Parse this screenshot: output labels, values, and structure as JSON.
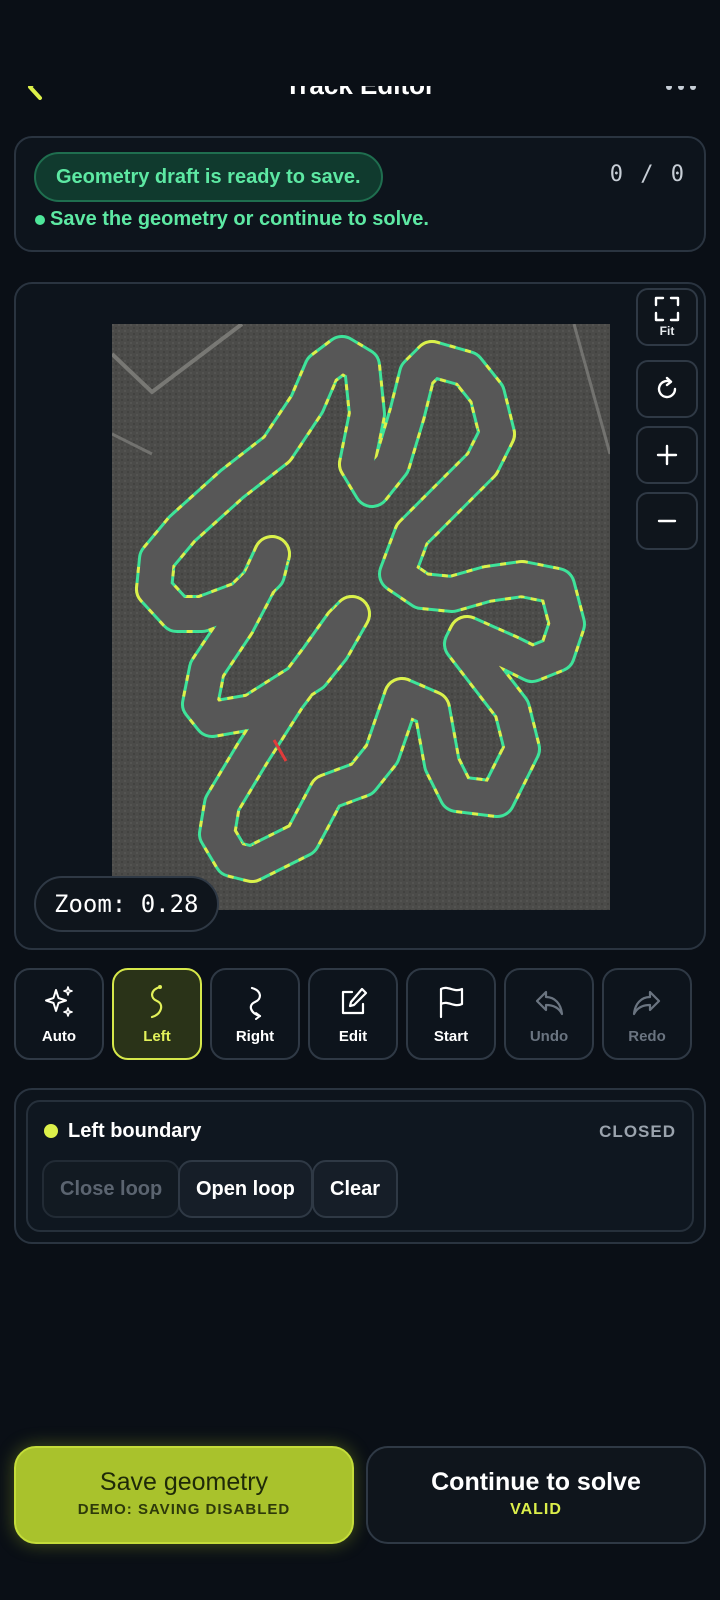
{
  "header": {
    "title": "Track Editor"
  },
  "status": {
    "pill": "Geometry draft is ready to save.",
    "counter": "0 / 0",
    "message": "Save the geometry or continue to solve."
  },
  "map": {
    "controls": {
      "fit_label": "Fit"
    },
    "zoom_text": "Zoom: 0.28"
  },
  "toolbar": {
    "tools": [
      {
        "label": "Auto",
        "icon": "sparkles-icon",
        "state": "normal"
      },
      {
        "label": "Left",
        "icon": "left-boundary-icon",
        "state": "active"
      },
      {
        "label": "Right",
        "icon": "right-boundary-icon",
        "state": "normal"
      },
      {
        "label": "Edit",
        "icon": "edit-icon",
        "state": "normal"
      },
      {
        "label": "Start",
        "icon": "flag-icon",
        "state": "normal"
      },
      {
        "label": "Undo",
        "icon": "undo-icon",
        "state": "disabled"
      },
      {
        "label": "Redo",
        "icon": "redo-icon",
        "state": "disabled"
      }
    ]
  },
  "boundary": {
    "title": "Left boundary",
    "state": "CLOSED",
    "close_loop": "Close loop",
    "open_loop": "Open loop",
    "clear": "Clear"
  },
  "actions": {
    "save": {
      "label": "Save geometry",
      "sub": "DEMO: SAVING DISABLED"
    },
    "solve": {
      "label": "Continue to solve",
      "sub": "VALID"
    }
  },
  "colors": {
    "accent": "#a9c22c",
    "left_boundary": "#dcf04a",
    "right_boundary": "#3ee39a",
    "status_green": "#5de8a3",
    "error_segment": "#e23b3b"
  }
}
